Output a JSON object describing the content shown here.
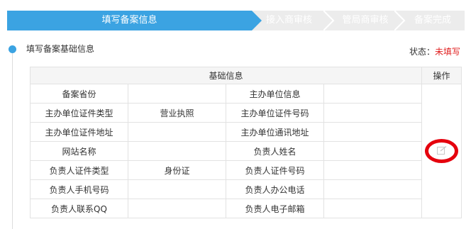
{
  "steps": [
    {
      "label": "填写备案信息",
      "active": true
    },
    {
      "label": "接入商审核",
      "active": false
    },
    {
      "label": "管局商审核",
      "active": false
    },
    {
      "label": "备案完成",
      "active": false
    }
  ],
  "section": {
    "title": "填写备案基础信息",
    "status_label": "状态：",
    "status_value": "未填写"
  },
  "table": {
    "header": "基础信息",
    "action_header": "操作",
    "rows": [
      {
        "l1": "备案省份",
        "v1": "",
        "l2": "主办单位信息",
        "v2": ""
      },
      {
        "l1": "主办单位证件类型",
        "v1": "营业执照",
        "l2": "主办单位证件号码",
        "v2": ""
      },
      {
        "l1": "主办单位证件地址",
        "v1": "",
        "l2": "主办单位通讯地址",
        "v2": ""
      },
      {
        "l1": "网站名称",
        "v1": "",
        "l2": "负责人姓名",
        "v2": ""
      },
      {
        "l1": "负责人证件类型",
        "v1": "身份证",
        "l2": "负责人证件号码",
        "v2": ""
      },
      {
        "l1": "负责人手机号码",
        "v1": "",
        "l2": "负责人办公电话",
        "v2": ""
      },
      {
        "l1": "负责人联系QQ",
        "v1": "",
        "l2": "负责人电子邮箱",
        "v2": ""
      }
    ],
    "edit_icon": "edit-icon",
    "highlight_color": "#e5000d"
  },
  "colors": {
    "accent": "#3ba3e2",
    "status": "#e02020"
  }
}
